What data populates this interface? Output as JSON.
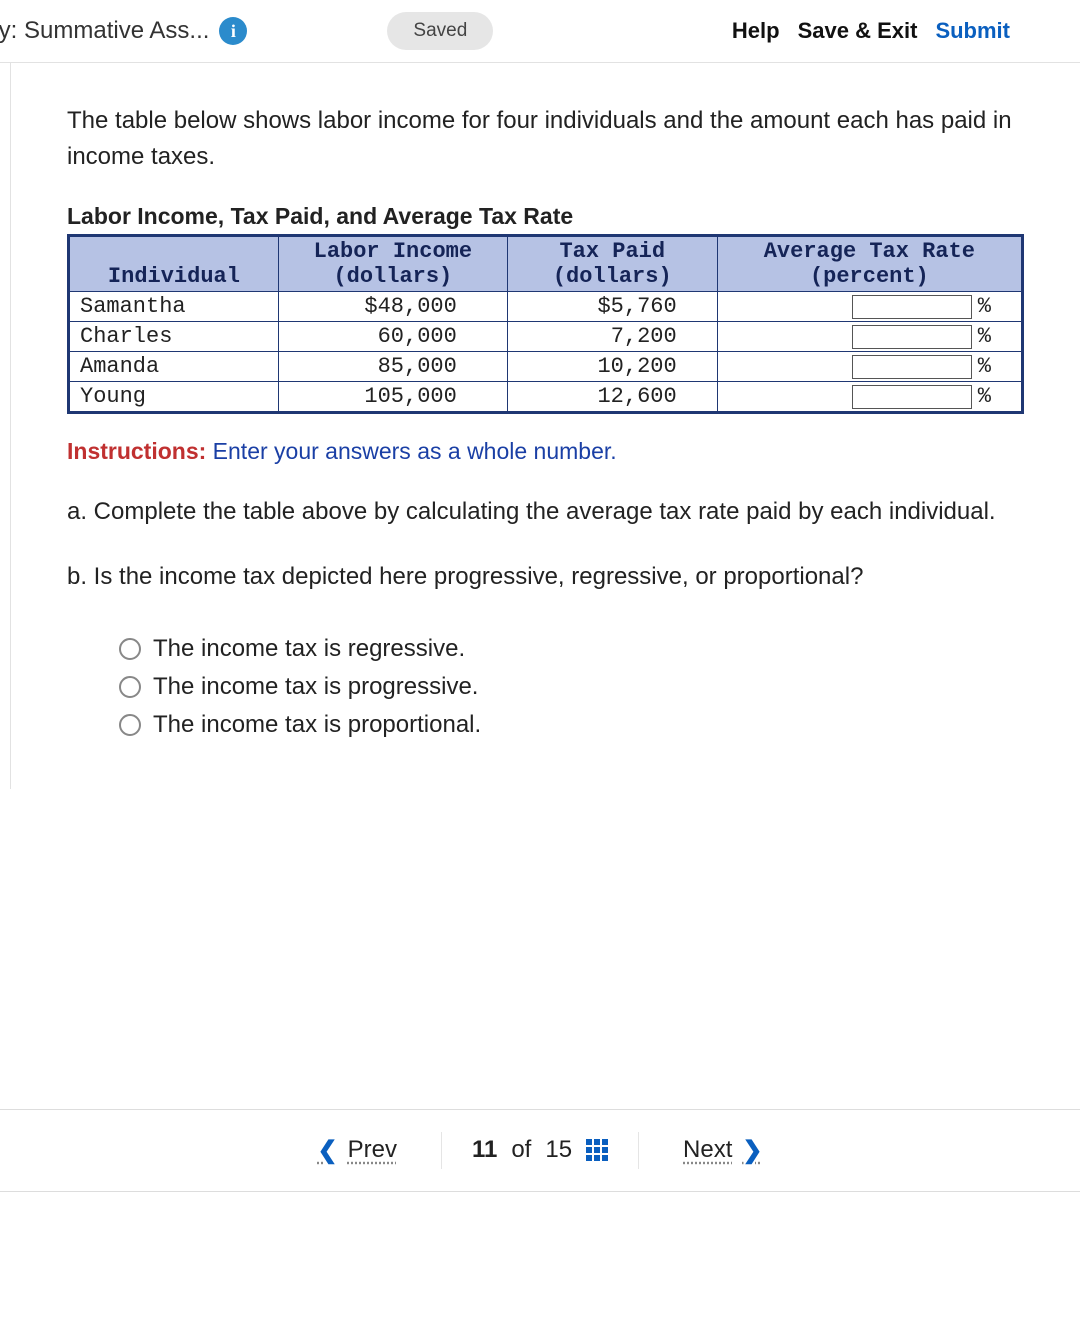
{
  "header": {
    "title": "ply: Summative Ass...",
    "saved_label": "Saved",
    "help_label": "Help",
    "save_exit_label": "Save & Exit",
    "submit_label": "Submit"
  },
  "question": {
    "intro": "The table below shows labor income for four individuals and the amount each has paid in income taxes.",
    "table_title": "Labor Income, Tax Paid, and Average Tax Rate",
    "columns": {
      "c0": "Individual",
      "c1_line1": "Labor Income",
      "c1_line2": "(dollars)",
      "c2_line1": "Tax Paid",
      "c2_line2": "(dollars)",
      "c3_line1": "Average Tax Rate",
      "c3_line2": "(percent)"
    },
    "rows": [
      {
        "name": "Samantha",
        "income": "$48,000",
        "tax": "$5,760",
        "rate": ""
      },
      {
        "name": "Charles",
        "income": "60,000",
        "tax": "7,200",
        "rate": ""
      },
      {
        "name": "Amanda",
        "income": "85,000",
        "tax": "10,200",
        "rate": ""
      },
      {
        "name": "Young",
        "income": "105,000",
        "tax": "12,600",
        "rate": ""
      }
    ],
    "pct_symbol": "%",
    "instructions_label": "Instructions:",
    "instructions_text": " Enter your answers as a whole number.",
    "part_a": "a. Complete the table above by calculating the average tax rate paid by each individual.",
    "part_b": "b. Is the income tax depicted here progressive, regressive, or proportional?",
    "options": [
      "The income tax is regressive.",
      "The income tax is progressive.",
      "The income tax is proportional."
    ]
  },
  "nav": {
    "prev": "Prev",
    "next": "Next",
    "current": "11",
    "of": "of",
    "total": "15"
  }
}
